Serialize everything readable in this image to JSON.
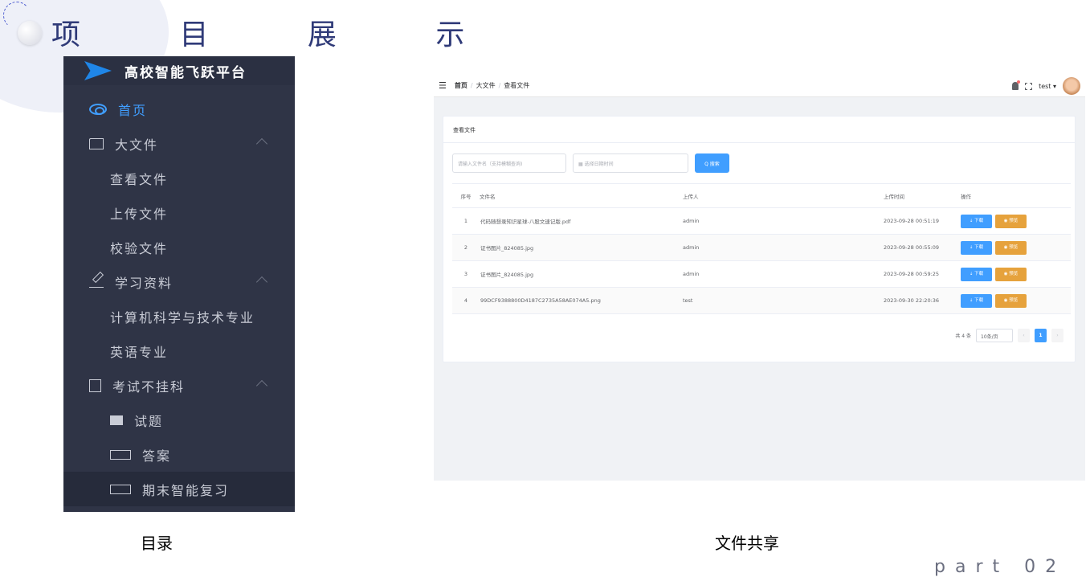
{
  "slide": {
    "title": "项 目 展 示",
    "caption_left": "目录",
    "caption_right": "文件共享",
    "part_label": "part 02"
  },
  "sidebar": {
    "title": "高校智能飞跃平台",
    "items": [
      {
        "label": "首页",
        "icon": "home-icon",
        "state": "active"
      },
      {
        "label": "大文件",
        "icon": "folder-icon",
        "expandable": true
      },
      {
        "label": "查看文件"
      },
      {
        "label": "上传文件"
      },
      {
        "label": "校验文件"
      },
      {
        "label": "学习资料",
        "icon": "pen-icon",
        "expandable": true
      },
      {
        "label": "计算机科学与技术专业"
      },
      {
        "label": "英语专业"
      },
      {
        "label": "考试不挂科",
        "icon": "document-icon",
        "expandable": true
      },
      {
        "label": "试题",
        "icon": "box-icon"
      },
      {
        "label": "答案",
        "icon": "keyboard-icon"
      },
      {
        "label": "期末智能复习",
        "icon": "keyboard-icon",
        "state": "selected"
      }
    ]
  },
  "app": {
    "breadcrumb": [
      "首页",
      "大文件",
      "查看文件"
    ],
    "user": "test ▾",
    "card_title": "查看文件",
    "search_placeholder": "请输入文件名（支持模糊查询)",
    "date_placeholder": "选择日期时间",
    "search_button": "Q 搜索",
    "table": {
      "headers": [
        "序号",
        "文件名",
        "上传人",
        "上传时间",
        "操作"
      ],
      "rows": [
        {
          "idx": "1",
          "name": "代码随想录知识星球-八股文速记版.pdf",
          "uploader": "admin",
          "time": "2023-09-28 00:51:19"
        },
        {
          "idx": "2",
          "name": "证书图片_824085.jpg",
          "uploader": "admin",
          "time": "2023-09-28 00:55:09"
        },
        {
          "idx": "3",
          "name": "证书图片_824085.jpg",
          "uploader": "admin",
          "time": "2023-09-28 00:59:25"
        },
        {
          "idx": "4",
          "name": "99DCF9388800D4187C2735A58AE074A5.png",
          "uploader": "test",
          "time": "2023-09-30 22:20:36"
        }
      ],
      "download_label": "⇣ 下载",
      "preview_label": "◉ 预览"
    },
    "pager": {
      "total": "共 4 条",
      "page_size": "10条/页",
      "prev": "‹",
      "current": "1",
      "next": "›"
    }
  },
  "colors": {
    "primary": "#409eff",
    "warning": "#e6a23c",
    "sidebar_bg": "#2f3446",
    "title": "#2f3a78"
  }
}
